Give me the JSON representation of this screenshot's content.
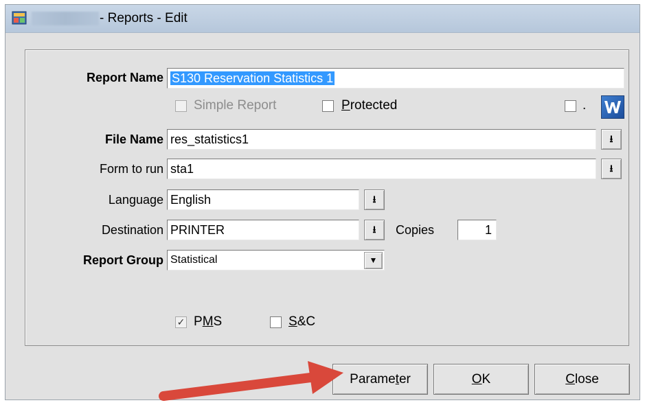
{
  "window": {
    "title": "- Reports - Edit"
  },
  "form": {
    "report_name": {
      "label": "Report Name",
      "value": "S130 Reservation Statistics 1"
    },
    "simple_report": {
      "label": "Simple Report",
      "checked": false,
      "disabled": true
    },
    "protected": {
      "label": "Protected",
      "checked": false
    },
    "extra_checkbox": {
      "label": ".",
      "checked": false
    },
    "file_name": {
      "label": "File Name",
      "value": "res_statistics1"
    },
    "form_to_run": {
      "label": "Form to run",
      "value": "sta1"
    },
    "language": {
      "label": "Language",
      "value": "English"
    },
    "destination": {
      "label": "Destination",
      "value": "PRINTER"
    },
    "copies": {
      "label": "Copies",
      "value": "1"
    },
    "report_group": {
      "label": "Report Group",
      "value": "Statistical"
    },
    "pms": {
      "label": "PMS",
      "checked": true,
      "mark": "✓"
    },
    "sc": {
      "label": "S&C",
      "checked": false
    }
  },
  "buttons": {
    "parameter": "Parameter",
    "ok": "OK",
    "close": "Close"
  },
  "icons": {
    "title_icon": "app-icon",
    "dropdown": "download-arrow-icon",
    "combo": "chevron-down-icon",
    "word": "word-icon",
    "annotation": "red-arrow-icon"
  },
  "colors": {
    "selection": "#3399ff",
    "arrow": "#d9483b"
  }
}
